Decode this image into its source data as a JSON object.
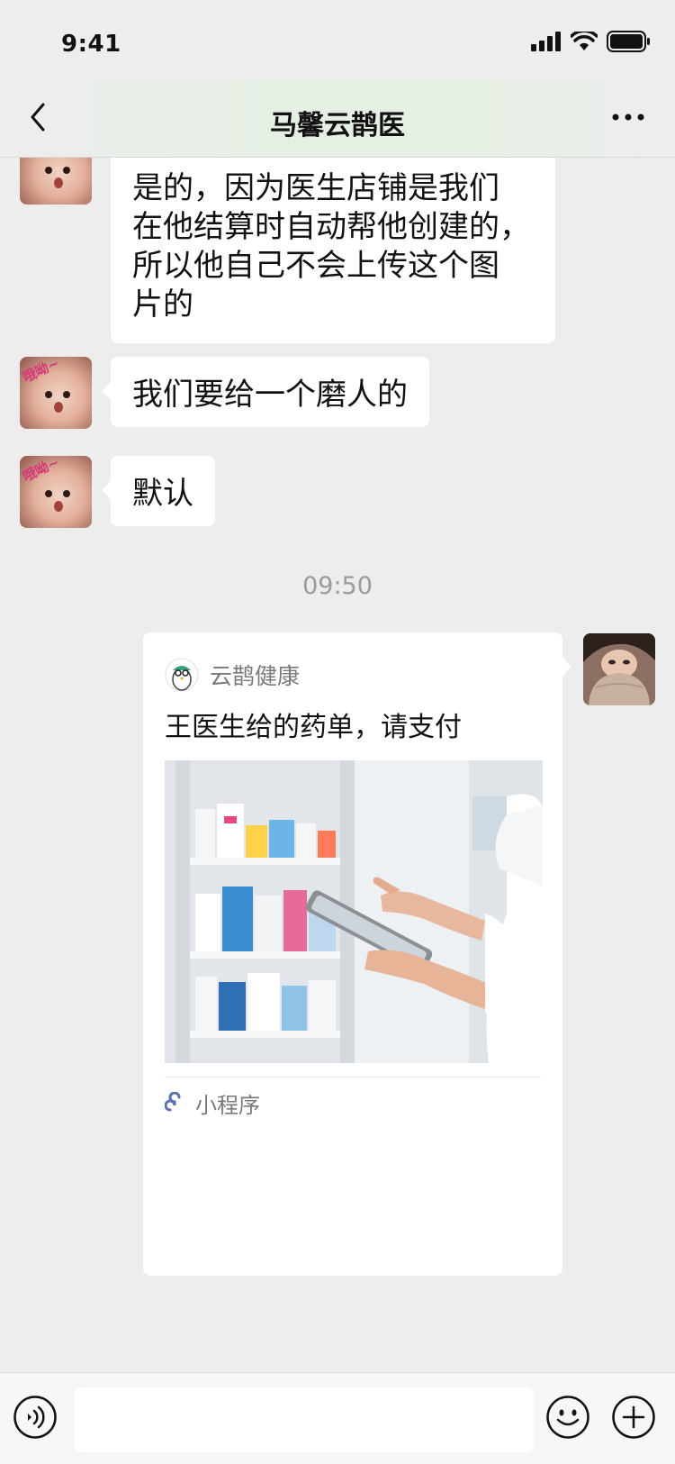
{
  "status_bar": {
    "time": "9:41"
  },
  "nav": {
    "title": "马馨云鹊医"
  },
  "messages": {
    "msg1_lines": [
      "是的，因为医生店铺是我们",
      "在他结算时自动帮他创建的，",
      "所以他自己不会上传这个图",
      "片的"
    ],
    "msg2": "我们要给一个磨人的",
    "msg3": "默认",
    "timestamp": "09:50"
  },
  "avatar_tag": "哦呦~",
  "card": {
    "app_name": "云鹊健康",
    "title": "王医生给的药单，请支付",
    "footer_label": "小程序"
  },
  "input_bar": {
    "placeholder": ""
  },
  "colors": {
    "bubble": "#ffffff",
    "background": "#ededed",
    "timestamp": "#9b9b9b",
    "footer_icon": "#5b6fb3"
  }
}
